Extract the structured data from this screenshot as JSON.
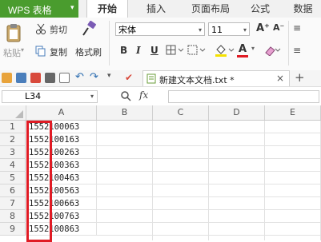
{
  "app": {
    "title": "WPS 表格",
    "menu_arrow": "▾"
  },
  "tabs": [
    "开始",
    "插入",
    "页面布局",
    "公式",
    "数据"
  ],
  "ribbon": {
    "paste_label": "粘贴",
    "cut_label": "剪切",
    "copy_label": "复制",
    "format_painter_label": "格式刷",
    "font_name": "宋体",
    "font_size": "11",
    "bold": "B",
    "italic": "I",
    "underline": "U",
    "increase_font": "A⁺",
    "decrease_font": "A⁻",
    "font_color_glyph": "A"
  },
  "document_tab": {
    "name": "新建文本文档.txt *",
    "close": "×",
    "new_tab": "+"
  },
  "formula_bar": {
    "cell_ref": "L34",
    "fx": "fx"
  },
  "columns": [
    "A",
    "B",
    "C",
    "D",
    "E"
  ],
  "rows": [
    {
      "num": "1",
      "a": "1552100063"
    },
    {
      "num": "2",
      "a": "1552100163"
    },
    {
      "num": "3",
      "a": "1552100263"
    },
    {
      "num": "4",
      "a": "1552100363"
    },
    {
      "num": "5",
      "a": "1552100463"
    },
    {
      "num": "6",
      "a": "1552100563"
    },
    {
      "num": "7",
      "a": "1552100663"
    },
    {
      "num": "8",
      "a": "1552100763"
    },
    {
      "num": "9",
      "a": "1552100863"
    }
  ],
  "colors": {
    "wps_green": "#4a9c2e",
    "highlight_red": "#e01b24"
  }
}
